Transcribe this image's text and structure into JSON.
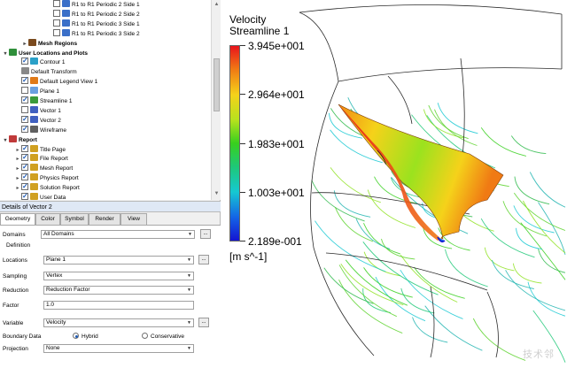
{
  "tree": {
    "rows": [
      {
        "label": "R1 to R1 Periodic 2 Side 1",
        "indent": 50,
        "checkbox": "off",
        "icon": "interface-icon",
        "bold": false
      },
      {
        "label": "R1 to R1 Periodic 2 Side 2",
        "indent": 50,
        "checkbox": "off",
        "icon": "interface-icon",
        "bold": false
      },
      {
        "label": "R1 to R1 Periodic 3 Side 1",
        "indent": 50,
        "checkbox": "off",
        "icon": "interface-icon",
        "bold": false
      },
      {
        "label": "R1 to R1 Periodic 3 Side 2",
        "indent": 50,
        "checkbox": "off",
        "icon": "interface-icon",
        "bold": false
      },
      {
        "label": "Mesh Regions",
        "indent": 22,
        "checkbox": "none",
        "icon": "mesh-regions-icon",
        "bold": true
      },
      {
        "label": "User Locations and Plots",
        "indent": 0,
        "checkbox": "none",
        "icon": "user-locations-icon",
        "bold": true
      },
      {
        "label": "Contour 1",
        "indent": 14,
        "checkbox": "on",
        "icon": "contour-icon",
        "bold": false
      },
      {
        "label": "Default Transform",
        "indent": 14,
        "checkbox": "none",
        "icon": "transform-icon",
        "bold": false
      },
      {
        "label": "Default Legend View 1",
        "indent": 14,
        "checkbox": "on",
        "icon": "legend-icon",
        "bold": false
      },
      {
        "label": "Plane 1",
        "indent": 14,
        "checkbox": "off",
        "icon": "plane-icon",
        "bold": false
      },
      {
        "label": "Streamline 1",
        "indent": 14,
        "checkbox": "on",
        "icon": "streamline-icon",
        "bold": false
      },
      {
        "label": "Vector 1",
        "indent": 14,
        "checkbox": "off",
        "icon": "vector-icon",
        "bold": false
      },
      {
        "label": "Vector 2",
        "indent": 14,
        "checkbox": "on",
        "icon": "vector-icon",
        "bold": false
      },
      {
        "label": "Wireframe",
        "indent": 14,
        "checkbox": "on",
        "icon": "wireframe-icon",
        "bold": false
      },
      {
        "label": "Report",
        "indent": 0,
        "checkbox": "none",
        "icon": "report-icon",
        "bold": true
      },
      {
        "label": "Title Page",
        "indent": 14,
        "checkbox": "on",
        "icon": "title-page-icon",
        "bold": false
      },
      {
        "label": "File Report",
        "indent": 14,
        "checkbox": "on",
        "icon": "file-report-icon",
        "bold": false
      },
      {
        "label": "Mesh Report",
        "indent": 14,
        "checkbox": "on",
        "icon": "mesh-report-icon",
        "bold": false
      },
      {
        "label": "Physics Report",
        "indent": 14,
        "checkbox": "on",
        "icon": "physics-report-icon",
        "bold": false
      },
      {
        "label": "Solution Report",
        "indent": 14,
        "checkbox": "on",
        "icon": "solution-report-icon",
        "bold": false
      },
      {
        "label": "User Data",
        "indent": 14,
        "checkbox": "on",
        "icon": "user-data-icon",
        "bold": false
      }
    ]
  },
  "details": {
    "title": "Details of Vector 2",
    "tabs": [
      "Geometry",
      "Color",
      "Symbol",
      "Render",
      "View"
    ],
    "active_tab": "Geometry",
    "domains_label": "Domains",
    "domains_value": "All Domains",
    "definition_label": "Definition",
    "locations_label": "Locations",
    "locations_value": "Plane 1",
    "sampling_label": "Sampling",
    "sampling_value": "Vertex",
    "reduction_label": "Reduction",
    "reduction_value": "Reduction Factor",
    "factor_label": "Factor",
    "factor_value": "1.0",
    "variable_label": "Variable",
    "variable_value": "Velocity",
    "boundary_label": "Boundary Data",
    "hybrid_label": "Hybrid",
    "conservative_label": "Conservative",
    "boundary_selected": "Hybrid",
    "projection_label": "Projection",
    "projection_value": "None",
    "ellipsis": "..."
  },
  "legend": {
    "title_line1": "Velocity",
    "title_line2": "Streamline 1",
    "ticks": [
      "3.945e+001",
      "2.964e+001",
      "1.983e+001",
      "1.003e+001",
      "2.189e-001"
    ],
    "units": "[m s^-1]",
    "colors": {
      "max": "#e8141c",
      "mid": "#38d01e",
      "min": "#1414d2"
    }
  },
  "watermark": "技术邻"
}
